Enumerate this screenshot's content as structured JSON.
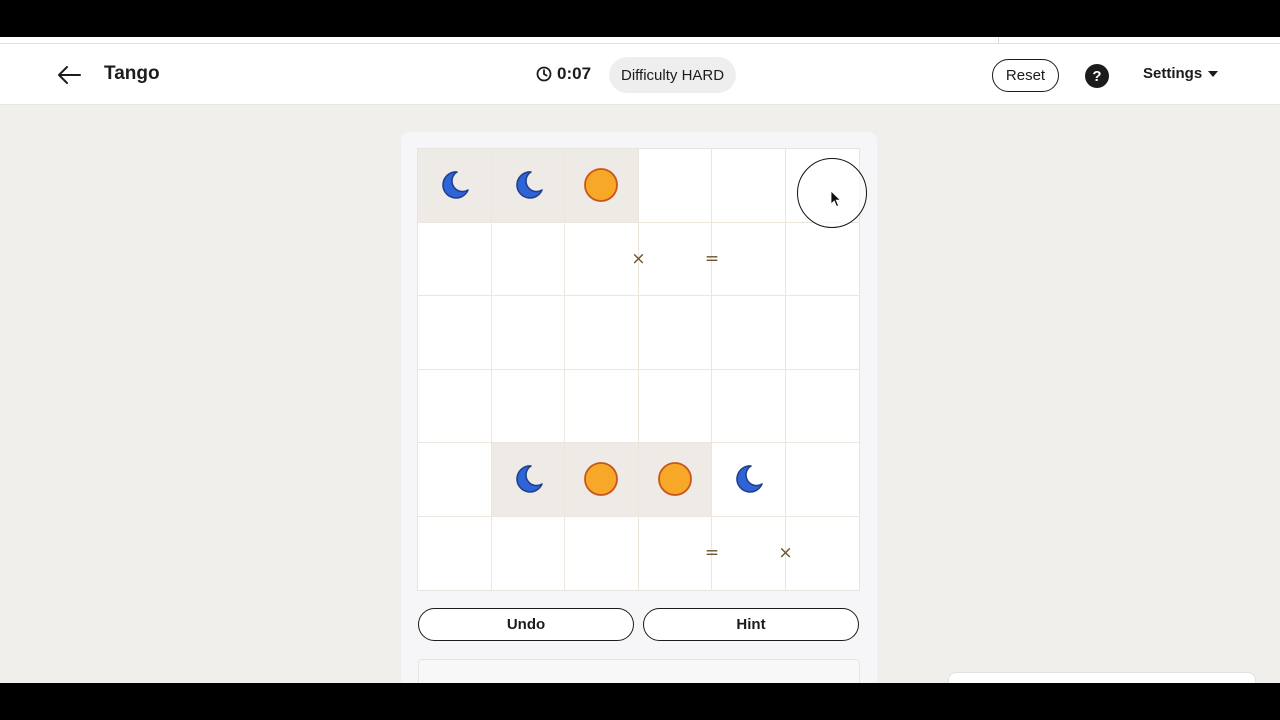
{
  "header": {
    "title": "Tango",
    "timer": "0:07",
    "difficulty": "Difficulty HARD",
    "reset_label": "Reset",
    "help_label": "?",
    "settings_label": "Settings"
  },
  "board": {
    "size": 6,
    "cells": [
      [
        "moon",
        "moon",
        "sun",
        "",
        "",
        ""
      ],
      [
        "",
        "",
        "",
        "",
        "",
        ""
      ],
      [
        "",
        "",
        "",
        "",
        "",
        ""
      ],
      [
        "",
        "",
        "",
        "",
        "",
        ""
      ],
      [
        "",
        "moon",
        "sun",
        "sun",
        "moon",
        ""
      ],
      [
        "",
        "",
        "",
        "",
        "",
        ""
      ]
    ],
    "locked": [
      [
        0,
        0
      ],
      [
        0,
        1
      ],
      [
        0,
        2
      ],
      [
        4,
        1
      ],
      [
        4,
        2
      ],
      [
        4,
        3
      ]
    ],
    "constraints": [
      {
        "row": 1,
        "col": 2,
        "side": "right",
        "symbol": "×"
      },
      {
        "row": 1,
        "col": 3,
        "side": "right",
        "symbol": "="
      },
      {
        "row": 5,
        "col": 3,
        "side": "right",
        "symbol": "="
      },
      {
        "row": 5,
        "col": 4,
        "side": "right",
        "symbol": "×"
      }
    ]
  },
  "actions": {
    "undo_label": "Undo",
    "hint_label": "Hint"
  },
  "colors": {
    "moon": "#2f64d6",
    "moon_stroke": "#1f3f8f",
    "sun": "#f7a828",
    "sun_stroke": "#c8561c",
    "locked_cell": "#eeeae6",
    "constraint": "#6b5230"
  }
}
